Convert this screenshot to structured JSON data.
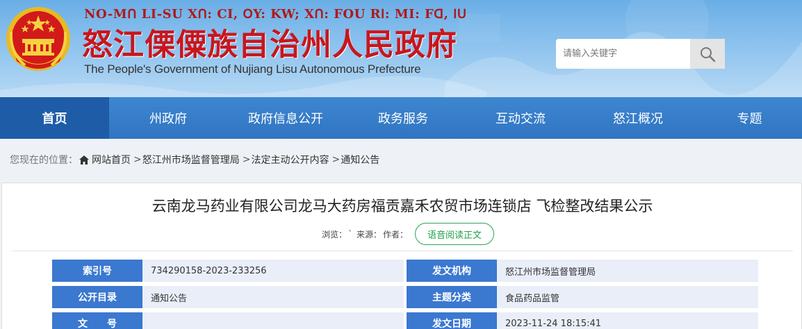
{
  "header": {
    "lisu_text": "NO-Mꓵ LI-SU Xꓵ: CI, ꓳY: KW; Xꓵ: FOU Rꓲ: MI: Fꓷ, ꓲꓴ",
    "cn_title": "怒江傈僳族自治州人民政府",
    "en_title": "The People's Government of Nujiang Lisu Autonomous Prefecture",
    "search_placeholder": "请输入关键字",
    "colors": {
      "title_red": "#c8161d",
      "sky_blue": "#6aaee6"
    }
  },
  "nav": {
    "items": [
      {
        "label": "首页",
        "active": true
      },
      {
        "label": "州政府",
        "active": false
      },
      {
        "label": "政府信息公开",
        "active": false
      },
      {
        "label": "政务服务",
        "active": false
      },
      {
        "label": "互动交流",
        "active": false
      },
      {
        "label": "怒江概况",
        "active": false
      },
      {
        "label": "专题",
        "active": false
      }
    ],
    "color": "#3f86d0",
    "active_color": "#1e5ca8"
  },
  "breadcrumb": {
    "label": "您现在的位置：",
    "home_icon": "home-icon",
    "items": [
      "网站首页",
      "怒江州市场监督管理局",
      "法定主动公开内容",
      "通知公告"
    ],
    "separator": ">"
  },
  "article": {
    "title": "云南龙马药业有限公司龙马大药房福贡嘉禾农贸市场连锁店 飞检整改结果公示",
    "views_label": "浏览：",
    "views_value": "`",
    "source_label": "来源：",
    "author_label": "作者：",
    "tts_label": "语音阅读正文"
  },
  "info_table": {
    "rows": [
      [
        {
          "label": "索引号",
          "value": "734290158-2023-233256"
        },
        {
          "label": "发文机构",
          "value": "怒江州市场监督管理局"
        }
      ],
      [
        {
          "label": "公开目录",
          "value": "通知公告"
        },
        {
          "label": "主题分类",
          "value": "食品药品监管"
        }
      ],
      [
        {
          "label": "文　　号",
          "value": ""
        },
        {
          "label": "发文日期",
          "value": "2023-11-24 18:15:41"
        }
      ]
    ],
    "label_color": "#3b78d0"
  }
}
